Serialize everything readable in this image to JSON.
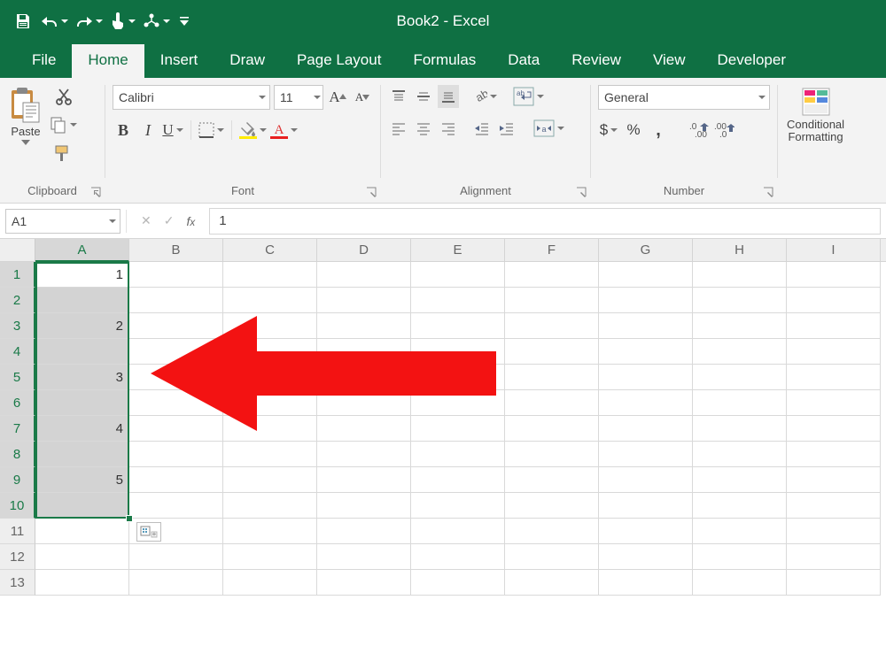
{
  "app": {
    "title": "Book2  -  Excel"
  },
  "tabs": [
    "File",
    "Home",
    "Insert",
    "Draw",
    "Page Layout",
    "Formulas",
    "Data",
    "Review",
    "View",
    "Developer"
  ],
  "activeTab": 1,
  "ribbon": {
    "clipboard": {
      "paste": "Paste",
      "label": "Clipboard"
    },
    "font": {
      "name": "Calibri",
      "size": "11",
      "bold": "B",
      "italic": "I",
      "underline": "U",
      "label": "Font"
    },
    "alignment": {
      "label": "Alignment"
    },
    "number": {
      "format": "General",
      "label": "Number"
    },
    "cond": {
      "line1": "Conditional",
      "line2": "Formatting"
    }
  },
  "fbar": {
    "name": "A1",
    "value": "1"
  },
  "columns": [
    "A",
    "B",
    "C",
    "D",
    "E",
    "F",
    "G",
    "H",
    "I"
  ],
  "rowcount": 13,
  "selectedCol": 0,
  "selectedRows": [
    1,
    10
  ],
  "cells": {
    "A1": "1",
    "A3": "2",
    "A5": "3",
    "A7": "4",
    "A9": "5"
  }
}
